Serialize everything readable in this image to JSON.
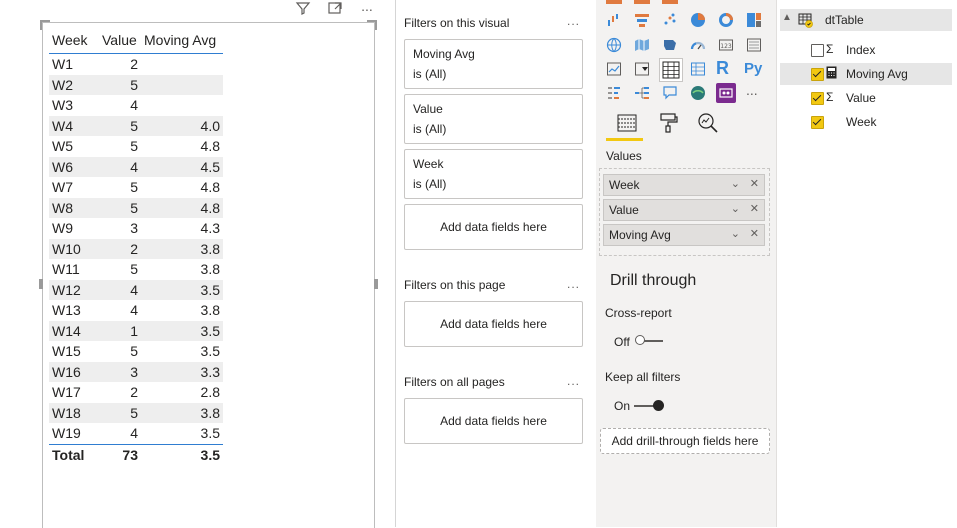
{
  "table": {
    "headers": [
      "Week",
      "Value",
      "Moving Avg"
    ],
    "rows": [
      [
        "W1",
        "2",
        ""
      ],
      [
        "W2",
        "5",
        ""
      ],
      [
        "W3",
        "4",
        ""
      ],
      [
        "W4",
        "5",
        "4.0"
      ],
      [
        "W5",
        "5",
        "4.8"
      ],
      [
        "W6",
        "4",
        "4.5"
      ],
      [
        "W7",
        "5",
        "4.8"
      ],
      [
        "W8",
        "5",
        "4.8"
      ],
      [
        "W9",
        "3",
        "4.3"
      ],
      [
        "W10",
        "2",
        "3.8"
      ],
      [
        "W11",
        "5",
        "3.8"
      ],
      [
        "W12",
        "4",
        "3.5"
      ],
      [
        "W13",
        "4",
        "3.8"
      ],
      [
        "W14",
        "1",
        "3.5"
      ],
      [
        "W15",
        "5",
        "3.5"
      ],
      [
        "W16",
        "3",
        "3.3"
      ],
      [
        "W17",
        "2",
        "2.8"
      ],
      [
        "W18",
        "5",
        "3.8"
      ],
      [
        "W19",
        "4",
        "3.5"
      ]
    ],
    "total": [
      "Total",
      "73",
      "3.5"
    ]
  },
  "visual_header": {
    "icons": [
      "filter-icon",
      "focus-mode-icon",
      "more-options-icon"
    ]
  },
  "filters_pane": {
    "visual_title": "Filters on this visual",
    "dots": "...",
    "cards": [
      {
        "field": "Moving Avg",
        "state": "is (All)"
      },
      {
        "field": "Value",
        "state": "is (All)"
      },
      {
        "field": "Week",
        "state": "is (All)"
      }
    ],
    "add_fields": "Add data fields here",
    "page_title": "Filters on this page",
    "all_pages_title": "Filters on all pages"
  },
  "viz_pane": {
    "values_label": "Values",
    "wells": [
      "Week",
      "Value",
      "Moving Avg"
    ],
    "drill_title": "Drill through",
    "cross_report_label": "Cross-report",
    "cross_report_state": "Off",
    "keep_filters_label": "Keep all filters",
    "keep_filters_state": "On",
    "drill_add": "Add drill-through fields here",
    "r_label": "R",
    "py_label": "Py",
    "more": "..."
  },
  "fields_pane": {
    "table_name": "dtTable",
    "fields": [
      {
        "name": "Index",
        "type": "sigma",
        "checked": false
      },
      {
        "name": "Moving Avg",
        "type": "calculator",
        "checked": true,
        "selected": true
      },
      {
        "name": "Value",
        "type": "sigma",
        "checked": true
      },
      {
        "name": "Week",
        "type": "none",
        "checked": true
      }
    ]
  },
  "colors": {
    "accent_yellow": "#f2c811",
    "table_underline": "#2f7dd1",
    "pane_bg": "#f3f2f1",
    "band": "#eeeeee"
  }
}
